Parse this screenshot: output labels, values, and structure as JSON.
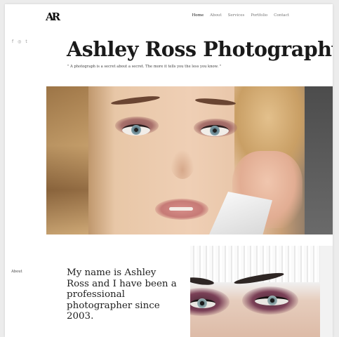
{
  "brand": {
    "logo": "AR"
  },
  "nav": {
    "items": [
      {
        "label": "Home",
        "active": true
      },
      {
        "label": "About",
        "active": false
      },
      {
        "label": "Services",
        "active": false
      },
      {
        "label": "Portfolio",
        "active": false
      },
      {
        "label": "Contact",
        "active": false
      }
    ]
  },
  "social": {
    "items": [
      {
        "icon": "facebook-icon",
        "glyph": "f"
      },
      {
        "icon": "instagram-icon",
        "glyph": "◎"
      },
      {
        "icon": "tumblr-icon",
        "glyph": "t"
      }
    ]
  },
  "hero": {
    "title": "Ashley Ross Photography",
    "tagline": "\" A photograph is a secret about a secret. The more it tells you the less you know. \""
  },
  "slider": {
    "prev_icon": "chevron-left-icon",
    "next_icon": "chevron-right-icon",
    "prev_glyph": "‹",
    "next_glyph": "›"
  },
  "about": {
    "label": "About",
    "text": "My name is Ashley Ross and I have been a professional photographer since 2003."
  },
  "colors": {
    "background": "#ffffff",
    "text": "#1a1a1a",
    "muted": "#777777"
  }
}
